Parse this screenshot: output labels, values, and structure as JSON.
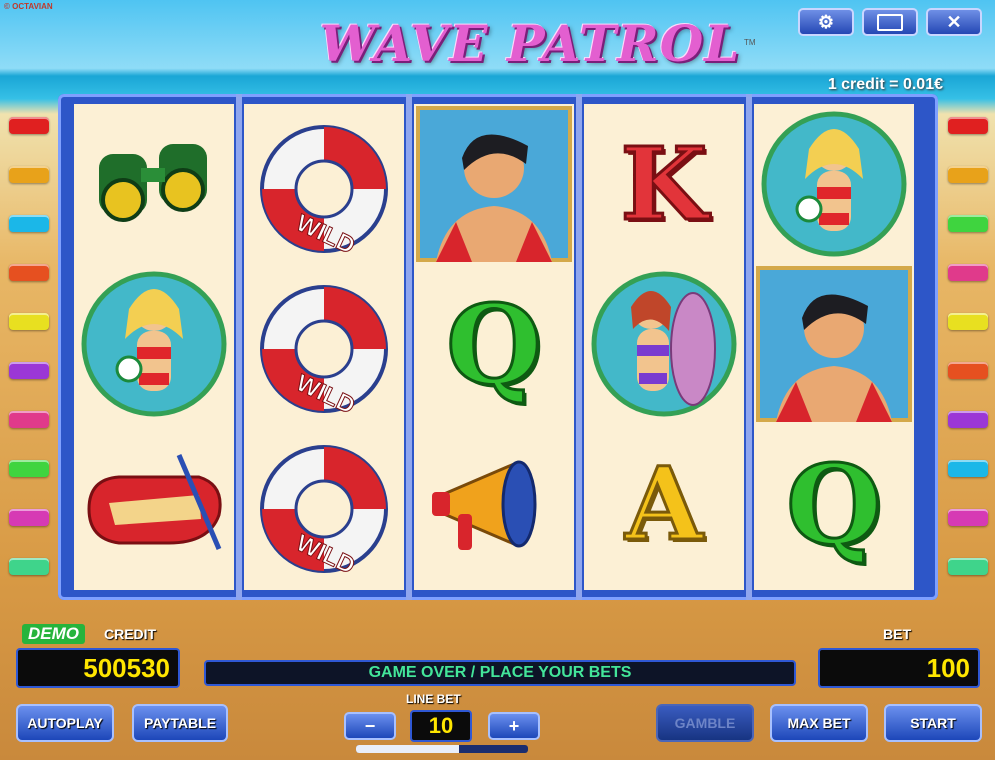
{
  "header": {
    "copyright": "© OCTAVIAN",
    "title": "WAVE PATROL",
    "trademark": "TM",
    "credit_rate": "1 credit = 0.01€"
  },
  "top_buttons": [
    {
      "name": "settings-button",
      "icon": "gear-icon",
      "glyph": "⚙"
    },
    {
      "name": "window-button",
      "icon": "window-icon",
      "glyph": ""
    },
    {
      "name": "close-button",
      "icon": "close-icon",
      "glyph": "✕"
    }
  ],
  "line_indicator_colors": {
    "left": [
      "#e02020",
      "#e8a21a",
      "#1bb7e8",
      "#e65020",
      "#e8e020",
      "#9b37d6",
      "#e03a8b",
      "#3fd43f",
      "#d63ab4",
      "#3fd48b"
    ],
    "right": [
      "#e02020",
      "#e8a21a",
      "#3fd43f",
      "#e03a8b",
      "#e8e020",
      "#e65020",
      "#9b37d6",
      "#1bb7e8",
      "#d63ab4",
      "#3fd48b"
    ]
  },
  "reels": [
    [
      "binoculars",
      "lifeguard-girl",
      "rubber-boat"
    ],
    [
      "wild-lifebuoy",
      "wild-lifebuoy",
      "wild-lifebuoy"
    ],
    [
      "lifeguard-man",
      "letter-q",
      "megaphone"
    ],
    [
      "letter-k",
      "surfer-girl",
      "letter-a"
    ],
    [
      "lifeguard-girl",
      "lifeguard-man",
      "letter-q"
    ]
  ],
  "symbol_text": {
    "wild": "WILD",
    "k": "K",
    "q": "Q",
    "a": "A"
  },
  "bottom": {
    "demo": "DEMO",
    "credit_label": "CREDIT",
    "credit_value": "500530",
    "message": "GAME OVER / PLACE YOUR BETS",
    "bet_label": "BET",
    "bet_value": "100",
    "line_bet_label": "LINE BET",
    "line_bet_value": "10",
    "minus": "−",
    "plus": "+",
    "autoplay": "AUTOPLAY",
    "paytable": "PAYTABLE",
    "gamble": "GAMBLE",
    "max_bet": "MAX BET",
    "start": "START",
    "line_bet_progress": 0.6
  }
}
